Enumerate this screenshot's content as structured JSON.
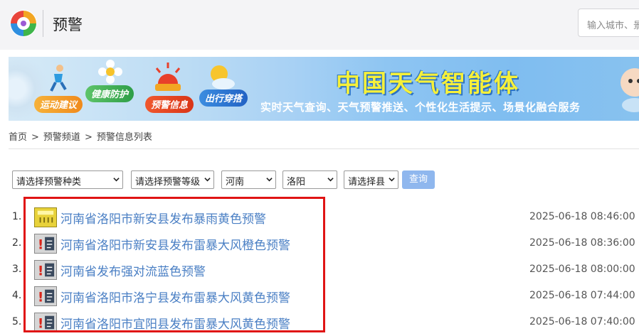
{
  "header": {
    "title": "预警",
    "search_placeholder": "输入城市、景"
  },
  "banner": {
    "tags": [
      "运动建议",
      "健康防护",
      "预警信息",
      "出行穿搭"
    ],
    "title": "中国天气智能体",
    "subtitle": "实时天气查询、天气预警推送、个性化生活提示、场景化融合服务"
  },
  "breadcrumb": {
    "home": "首页",
    "sep": ">",
    "channel": "预警频道",
    "current": "预警信息列表"
  },
  "filters": {
    "type": "请选择预警种类",
    "level": "请选择预警等级",
    "province": "河南",
    "city": "洛阳",
    "county": "请选择县",
    "query_label": "查询"
  },
  "alerts": [
    {
      "index": "1.",
      "title": "河南省洛阳市新安县发布暴雨黄色预警",
      "time": "2025-06-18 08:46:00",
      "icon": "rainstorm-yellow-icon"
    },
    {
      "index": "2.",
      "title": "河南省洛阳市新安县发布雷暴大风橙色预警",
      "time": "2025-06-18 08:36:00",
      "icon": "thunderstorm-wind-icon"
    },
    {
      "index": "3.",
      "title": "河南省发布强对流蓝色预警",
      "time": "2025-06-18 08:00:00",
      "icon": "thunderstorm-wind-icon"
    },
    {
      "index": "4.",
      "title": "河南省洛阳市洛宁县发布雷暴大风黄色预警",
      "time": "2025-06-18 07:44:00",
      "icon": "thunderstorm-wind-icon"
    },
    {
      "index": "5.",
      "title": "河南省洛阳市宜阳县发布雷暴大风黄色预警",
      "time": "2025-06-18 07:40:00",
      "icon": "thunderstorm-wind-icon"
    }
  ],
  "colors": {
    "link": "#4a7fc4",
    "highlight": "#e01414",
    "query_button": "#8fb7ee"
  }
}
